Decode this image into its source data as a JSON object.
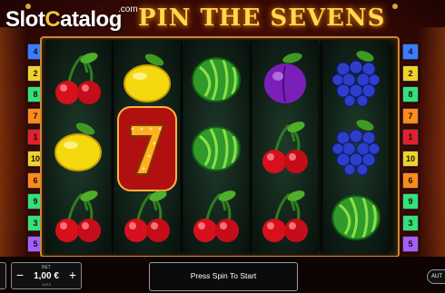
{
  "header": {
    "site_logo_main": "SlotCatalog",
    "site_logo_com": ".com",
    "game_title": "PIN THE SEVENS"
  },
  "reels": [
    [
      "cherry",
      "lemon",
      "cherry"
    ],
    [
      "lemon",
      "seven",
      "cherry"
    ],
    [
      "watermelon",
      "watermelon",
      "cherry"
    ],
    [
      "plum",
      "cherry",
      "cherry"
    ],
    [
      "grapes",
      "grapes",
      "watermelon"
    ]
  ],
  "left_markers": [
    "4",
    "2",
    "8",
    "7",
    "1",
    "10",
    "6",
    "9",
    "3",
    "5"
  ],
  "right_markers": [
    "4",
    "2",
    "8",
    "7",
    "1",
    "10",
    "6",
    "9",
    "3",
    "5"
  ],
  "marker_colors": {
    "4": "#3a7bff",
    "2": "#f2d22a",
    "8": "#35e07a",
    "7": "#ff8a1a",
    "1": "#e0212d",
    "10": "#f2d22a",
    "6": "#ff8a1a",
    "9": "#35e07a",
    "3": "#35e07a",
    "5": "#a65dff"
  },
  "bottom_bar": {
    "bet_label": "BET",
    "bet_value": "1,00 €",
    "bet_sub": "10/10",
    "minus": "−",
    "plus": "+",
    "message": "Press Spin To Start",
    "auto_label": "AUT"
  }
}
